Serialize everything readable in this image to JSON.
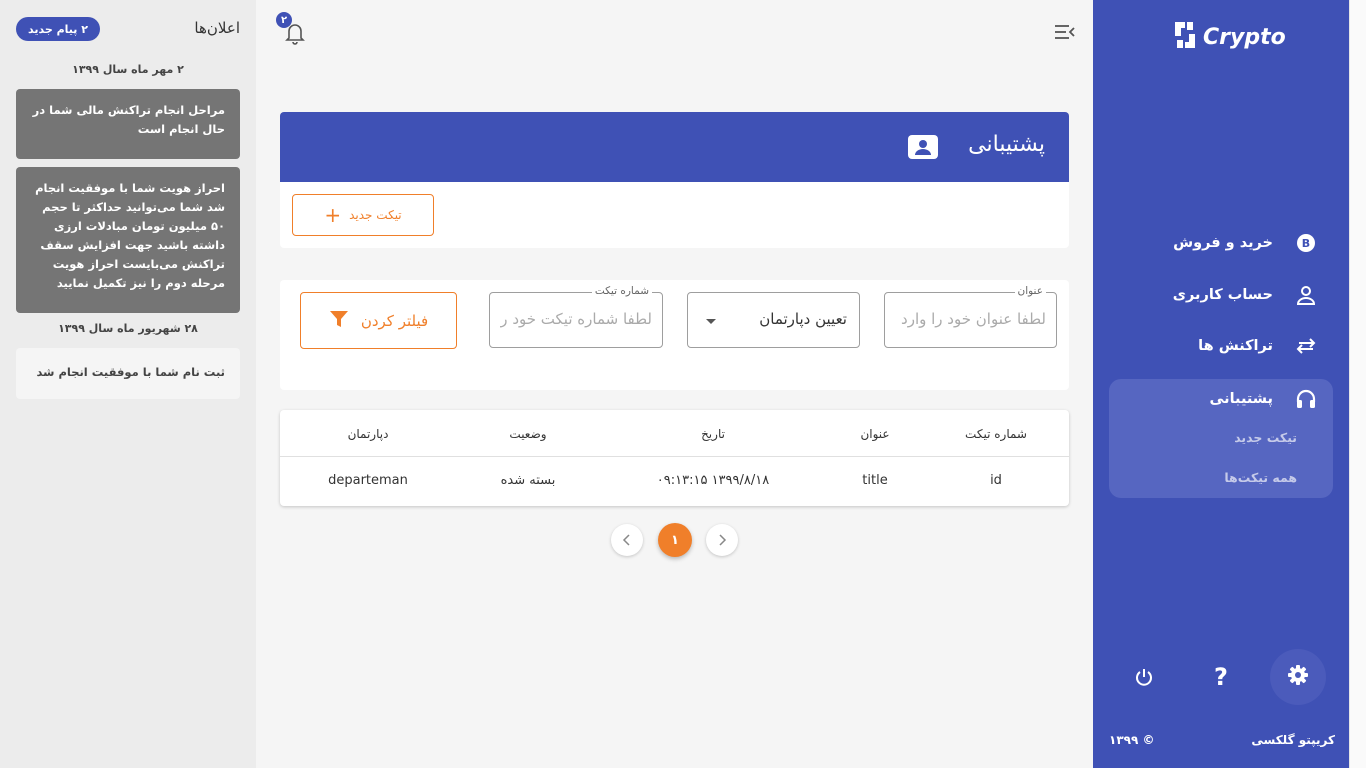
{
  "notifications": {
    "title": "اعلان‌ها",
    "new_badge": "۲ پیام جدید",
    "groups": [
      {
        "date": "۲ مهر ماه سال ۱۳۹۹",
        "items": [
          "مراحل انجام تراکنش مالی شما در حال انجام است",
          "احراز هویت شما با موفقیت انجام شد شما می‌توانید حداکثر تا حجم ۵۰ میلیون تومان مبادلات ارزی داشته باشید جهت افزایش سقف تراکنش می‌بایست احراز هویت مرحله دوم را نیز تکمیل نمایید"
        ]
      },
      {
        "date": "۲۸ شهریور ماه سال ۱۳۹۹",
        "items": [
          "ثبت نام شما با موفقیت انجام شد"
        ]
      }
    ]
  },
  "header": {
    "bell_count": "۲"
  },
  "support_card": {
    "title": "پشتیبانی",
    "new_ticket_label": "تیکت جدید"
  },
  "filters": {
    "title_label": "عنوان",
    "title_placeholder": "لطفا عنوان خود را وارد نمایید",
    "department_value": "تعیین دپارتمان",
    "ticket_number_label": "شماره تیکت",
    "ticket_number_placeholder": "لطفا شماره تیکت خود را وارد نمایید",
    "filter_button": "فیلتر کردن"
  },
  "table": {
    "headers": [
      "شماره تیکت",
      "عنوان",
      "تاریخ",
      "وضعیت",
      "دپارتمان"
    ],
    "rows": [
      [
        "id",
        "title",
        "۱۳۹۹/۸/۱۸ ۰۹:۱۳:۱۵",
        "بسته شده",
        "departeman"
      ]
    ]
  },
  "pagination": {
    "current": "۱"
  },
  "sidebar": {
    "brand": "Crypto",
    "items": [
      {
        "label": "خرید و فروش",
        "icon": "bitcoin-icon"
      },
      {
        "label": "حساب کاربری",
        "icon": "user-icon"
      },
      {
        "label": "تراکنش ها",
        "icon": "swap-icon"
      },
      {
        "label": "پشتیبانی",
        "icon": "headset-icon"
      }
    ],
    "sub_items": [
      "تیکت جدید",
      "همه تیکت‌ها"
    ],
    "footer_name": "کریپتو گلکسی",
    "footer_year": "© ۱۳۹۹"
  },
  "colors": {
    "primary": "#3f51b5",
    "accent": "#f07f2a",
    "notif_dark": "#757575"
  }
}
